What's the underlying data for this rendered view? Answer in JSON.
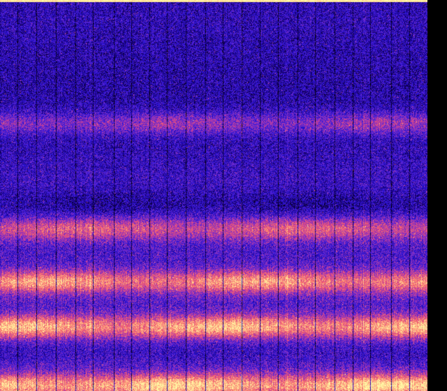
{
  "spectrogram": {
    "colormap": [
      "#000000",
      "#1a0080",
      "#2a14d8",
      "#6a2ad0",
      "#c03ca0",
      "#f05a70",
      "#ff9a78",
      "#ffe49a",
      "#ffffa8"
    ],
    "background": "#000000",
    "bright_bands": [
      {
        "center_fraction": 0.315,
        "intensity": 0.45
      },
      {
        "center_fraction": 0.585,
        "intensity": 0.6
      },
      {
        "center_fraction": 0.72,
        "intensity": 0.85
      },
      {
        "center_fraction": 0.835,
        "intensity": 0.95
      },
      {
        "center_fraction": 0.985,
        "intensity": 1.0
      }
    ],
    "dark_bands": [
      {
        "center_fraction": 0.52,
        "intensity": 0.35
      },
      {
        "center_fraction": 0.9,
        "intensity": 0.25
      }
    ]
  }
}
